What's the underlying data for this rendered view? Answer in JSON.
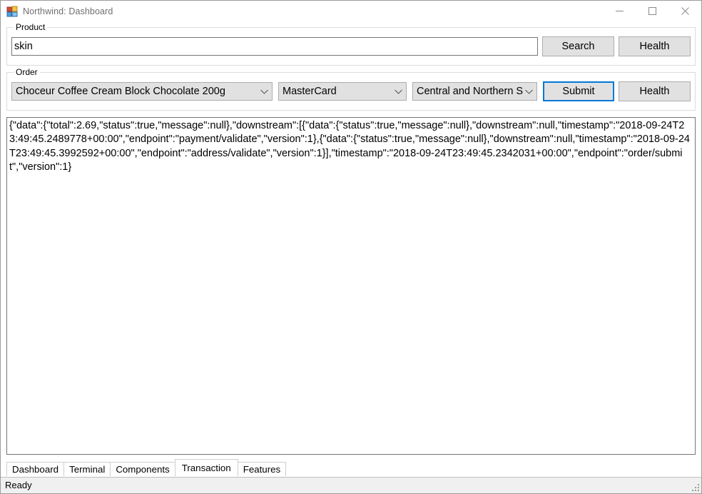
{
  "window": {
    "title": "Northwind: Dashboard",
    "icon": "winforms-app-icon",
    "controls": {
      "minimize": "minimize-icon",
      "maximize": "maximize-icon",
      "close": "close-icon"
    }
  },
  "product_group": {
    "legend": "Product",
    "search_field": {
      "value": "skin",
      "placeholder": ""
    },
    "search_button": "Search",
    "health_button": "Health"
  },
  "order_group": {
    "legend": "Order",
    "product_select": {
      "value": "Choceur Coffee Cream Block Chocolate 200g"
    },
    "payment_select": {
      "value": "MasterCard"
    },
    "region_select": {
      "value": "Central and Northern Syd"
    },
    "submit_button": "Submit",
    "health_button": "Health"
  },
  "output": {
    "text": "{\"data\":{\"total\":2.69,\"status\":true,\"message\":null},\"downstream\":[{\"data\":{\"status\":true,\"message\":null},\"downstream\":null,\"timestamp\":\"2018-09-24T23:49:45.2489778+00:00\",\"endpoint\":\"payment/validate\",\"version\":1},{\"data\":{\"status\":true,\"message\":null},\"downstream\":null,\"timestamp\":\"2018-09-24T23:49:45.3992592+00:00\",\"endpoint\":\"address/validate\",\"version\":1}],\"timestamp\":\"2018-09-24T23:49:45.2342031+00:00\",\"endpoint\":\"order/submit\",\"version\":1}"
  },
  "tabs": [
    {
      "label": "Dashboard",
      "selected": false
    },
    {
      "label": "Terminal",
      "selected": false
    },
    {
      "label": "Components",
      "selected": false
    },
    {
      "label": "Transaction",
      "selected": true
    },
    {
      "label": "Features",
      "selected": false
    }
  ],
  "status_bar": {
    "text": "Ready",
    "grip": "resize-grip-icon"
  },
  "colors": {
    "accent": "#0078d7",
    "button_face": "#e1e1e1",
    "button_border": "#adadad",
    "input_border": "#767676",
    "group_border": "#dcdcdc",
    "status_bar_bg": "#f0f0f0",
    "title_text": "#6f6f6f"
  }
}
